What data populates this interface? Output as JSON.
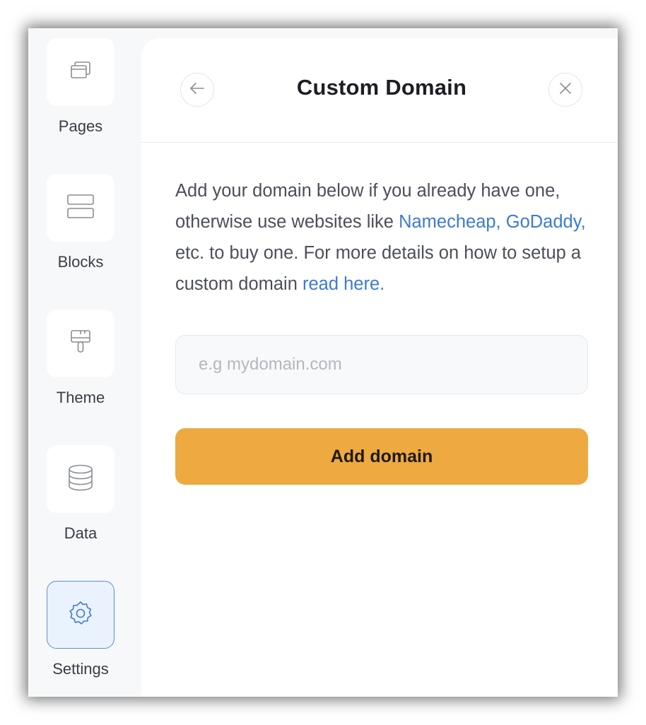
{
  "sidebar": {
    "items": [
      {
        "label": "Pages",
        "icon": "pages-icon",
        "active": false
      },
      {
        "label": "Blocks",
        "icon": "blocks-icon",
        "active": false
      },
      {
        "label": "Theme",
        "icon": "paintbrush-icon",
        "active": false
      },
      {
        "label": "Data",
        "icon": "database-icon",
        "active": false
      },
      {
        "label": "Settings",
        "icon": "gear-icon",
        "active": true
      }
    ]
  },
  "panel": {
    "title": "Custom Domain",
    "back_icon": "arrow-left-icon",
    "close_icon": "close-icon",
    "description": {
      "text_1": "Add your domain below if you already have one, otherwise use websites like ",
      "link_namecheap": "Namecheap,",
      "text_2": " ",
      "link_godaddy": "GoDaddy,",
      "text_3": " etc. to buy one. For more details on how to setup a custom domain ",
      "link_read_here": "read here."
    },
    "domain_input": {
      "placeholder": "e.g mydomain.com",
      "value": ""
    },
    "add_button_label": "Add domain"
  },
  "colors": {
    "accent_button": "#eea940",
    "link": "#3d7bd0",
    "active_tile_bg": "#eaf2fd",
    "active_tile_border": "#5b8fd6"
  }
}
